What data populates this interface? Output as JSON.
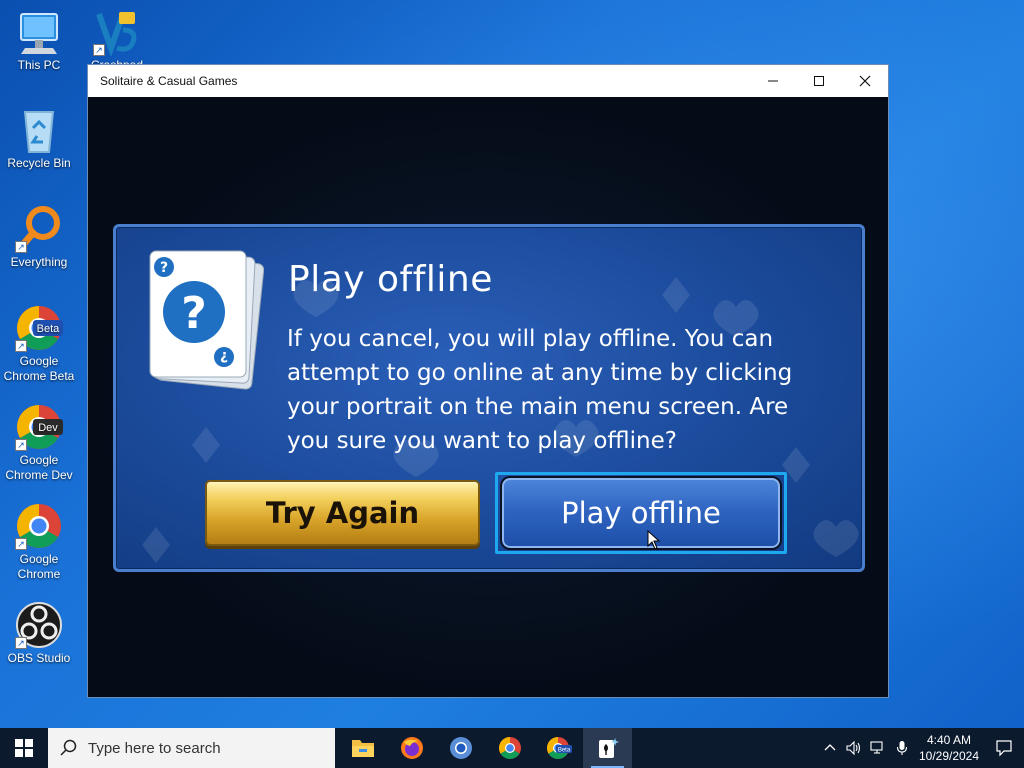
{
  "desktop": {
    "icons": [
      {
        "label": "This PC"
      },
      {
        "label": "Crashpad"
      },
      {
        "label": "Recycle Bin"
      },
      {
        "label": "Everything"
      },
      {
        "label": "Google Chrome Beta",
        "badge": "Beta"
      },
      {
        "label": "Google Chrome Dev",
        "badge": "Dev"
      },
      {
        "label": "Google Chrome"
      },
      {
        "label": "OBS Studio"
      }
    ]
  },
  "window": {
    "title": "Solitaire & Casual Games",
    "controls": {
      "minimize": "minimize-icon",
      "maximize": "maximize-icon",
      "close": "close-icon"
    }
  },
  "dialog": {
    "title": "Play offline",
    "body": "If you cancel, you will play offline. You can attempt to go online at any time by clicking your portrait on the main menu screen. Are you sure you want to play offline?",
    "card_icon": "question-mark-card-icon",
    "buttons": {
      "try_again": "Try Again",
      "play_offline": "Play offline"
    },
    "colors": {
      "gold": "#e0b038",
      "blue": "#2d63bf",
      "focus": "#1ea8f0"
    }
  },
  "taskbar": {
    "search_placeholder": "Type here to search",
    "apps": [
      "file-explorer-icon",
      "firefox-icon",
      "chromium-icon",
      "chrome-icon",
      "chrome-beta-icon",
      "solitaire-icon"
    ],
    "beta_badge": "Beta",
    "time": "4:40 AM",
    "date": "10/29/2024"
  }
}
